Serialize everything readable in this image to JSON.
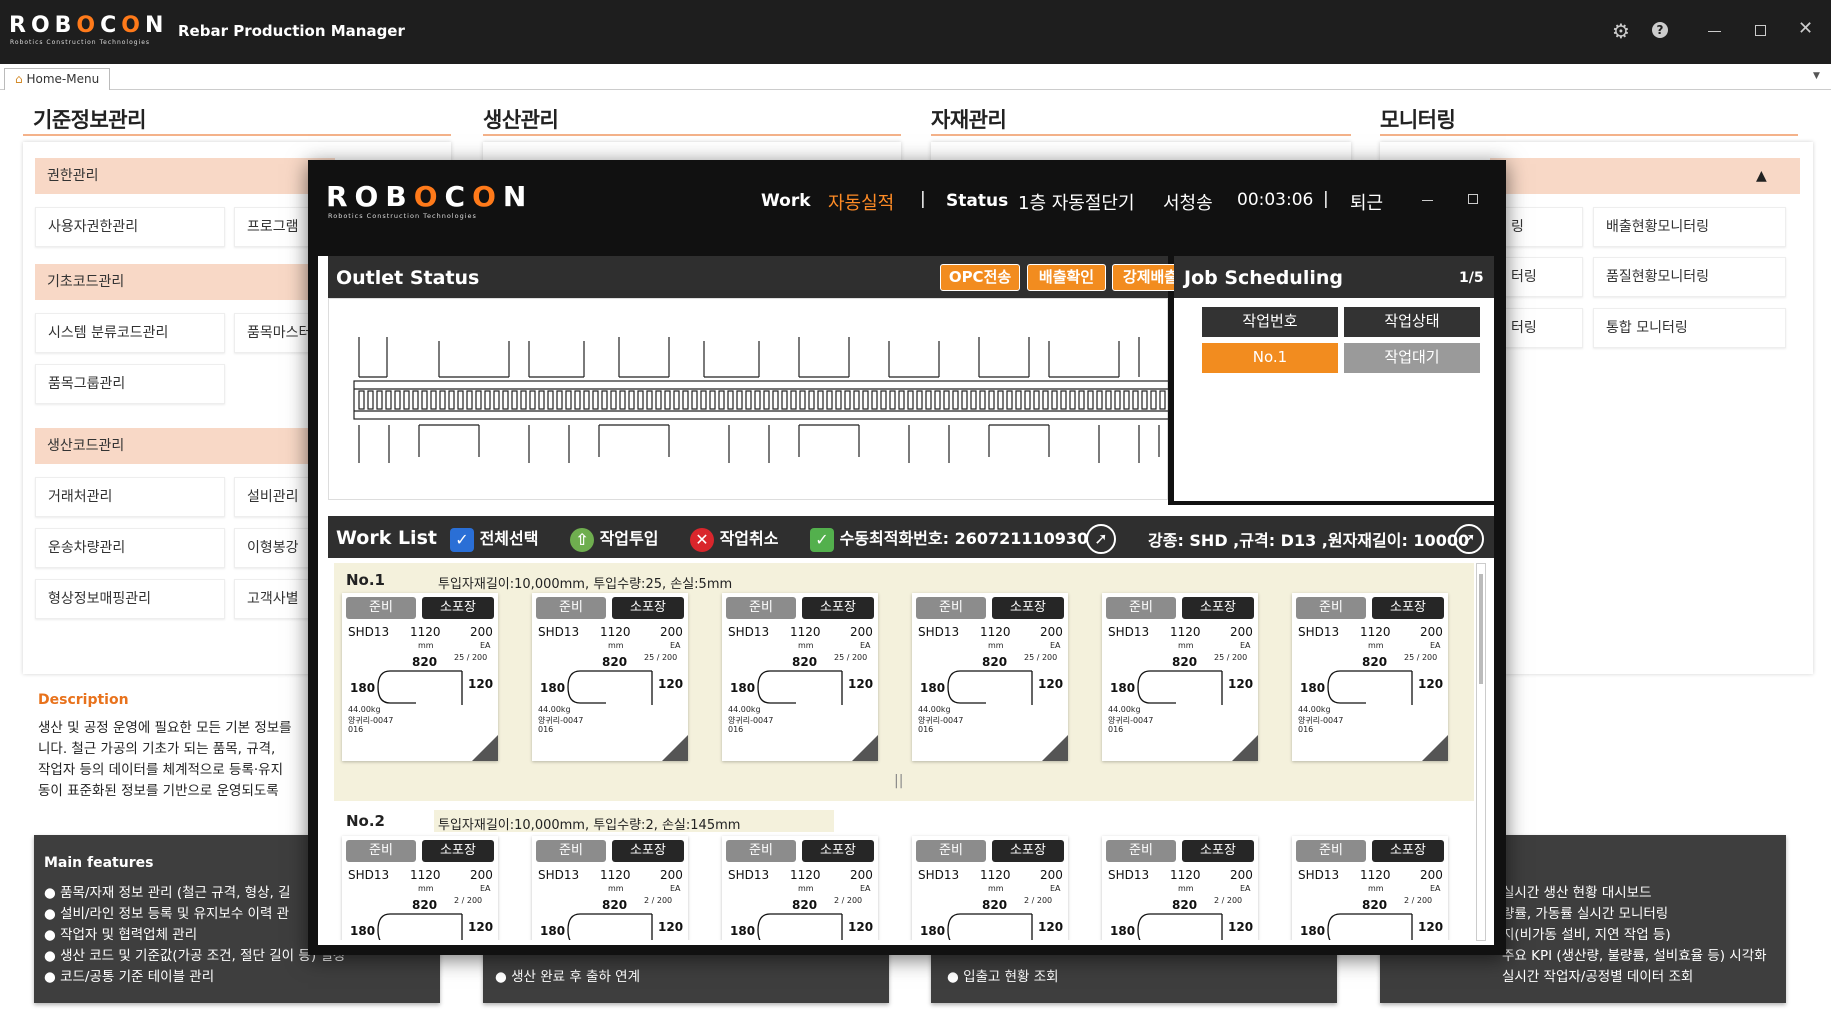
{
  "app": {
    "logo": "ROBOCON",
    "logo_sub": "Robotics Construction Technologies",
    "title": "Rebar Production Manager"
  },
  "tab": {
    "label": "Home-Menu"
  },
  "sections": {
    "basic": "기준정보관리",
    "production": "생산관리",
    "material": "자재관리",
    "monitoring": "모니터링"
  },
  "basic_menu": {
    "g1": "권한관리",
    "i1a": "사용자권한관리",
    "i1b": "프로그램",
    "g2": "기초코드관리",
    "i2a": "시스템 분류코드관리",
    "i2b": "품목마스터",
    "i2c": "품목그룹관리",
    "g3": "생산코드관리",
    "i3a": "거래처관리",
    "i3b": "설비관리",
    "i3c": "운송차량관리",
    "i3d": "이형봉강",
    "i3e": "형상정보매핑관리",
    "i3f": "고객사별"
  },
  "monitor_menu": {
    "a": "배출현황모니터링",
    "b": "품질현황모니터링",
    "c": "통합 모니터링",
    "p1": "링",
    "p2": "터링",
    "p3": "터링",
    "collapse": "▲"
  },
  "description": {
    "title": "Description",
    "lines": [
      "생산 및 공정 운영에 필요한 모든 기본 정보를",
      "니다.  철근 가공의 기초가 되는 품목, 규격,",
      "작업자 등의 데이터를 체계적으로 등록·유지",
      "동이 표준화된 정보를 기반으로 운영되도록"
    ]
  },
  "features": {
    "title": "Main features",
    "col1": [
      "품목/자재 정보 관리 (철근 규격, 형상, 길",
      "설비/라인 정보 등록 및 유지보수 이력 관",
      "작업자 및 협력업체 관리",
      "생산 코드 및 기준값(가공 조건, 절단 길이 등) 설정",
      "코드/공통 기준 테이블 관리"
    ],
    "col2": [
      "생산 완료 후 출하 연계"
    ],
    "col3": [
      "입출고 현황 조회"
    ],
    "col4": [
      "실시간 생산 현황 대시보드",
      "량률, 가동률 실시간 모니터링",
      "지(비가동 설비, 지연 작업 등)",
      "주요 KPI (생산량, 불량률, 설비효율 등) 시각화",
      "실시간 작업자/공정별 데이터 조회"
    ]
  },
  "modal": {
    "work": "Work",
    "mode": "자동실적",
    "status": "Status",
    "machine": "1층 자동절단기",
    "user": "서청송",
    "timer": "00:03:06",
    "leave": "퇴근",
    "sep": "|"
  },
  "outlet": {
    "title": "Outlet Status",
    "btn_opc": "OPC전송",
    "btn_confirm": "배출확인",
    "btn_force": "강제배출"
  },
  "job": {
    "title": "Job Scheduling",
    "page": "1/5",
    "col1": "작업번호",
    "col2": "작업상태",
    "job_no": "No.1",
    "job_state": "작업대기"
  },
  "worklist": {
    "title": "Work List",
    "select_all": "전체선택",
    "input": "작업투입",
    "cancel": "작업취소",
    "manual_no": "수동최적화번호: 260721110930",
    "spec": "강종: SHD ,규격: D13 ,원자재길이: 10000"
  },
  "rows": [
    {
      "no": "No.1",
      "info": "투입자재길이:10,000mm,  투입수량:25,  손실:5mm",
      "qty": "25 / 200"
    },
    {
      "no": "No.2",
      "info": "투입자재길이:10,000mm,  투입수량:2,  손실:145mm",
      "qty": "2 / 200"
    }
  ],
  "card": {
    "btn_ready": "준비",
    "btn_pack": "소포장",
    "grade": "SHD13",
    "length": "1120",
    "mm": "mm",
    "count": "200",
    "ea": "EA",
    "dim_top": "820",
    "dim_left": "180",
    "dim_right": "120",
    "weight": "44.00kg",
    "site": "양귀리-0047",
    "code": "016"
  },
  "colors": {
    "accent": "#f28c1f",
    "titlebar": "#1e1e1e",
    "group": "#f8d8c6"
  }
}
